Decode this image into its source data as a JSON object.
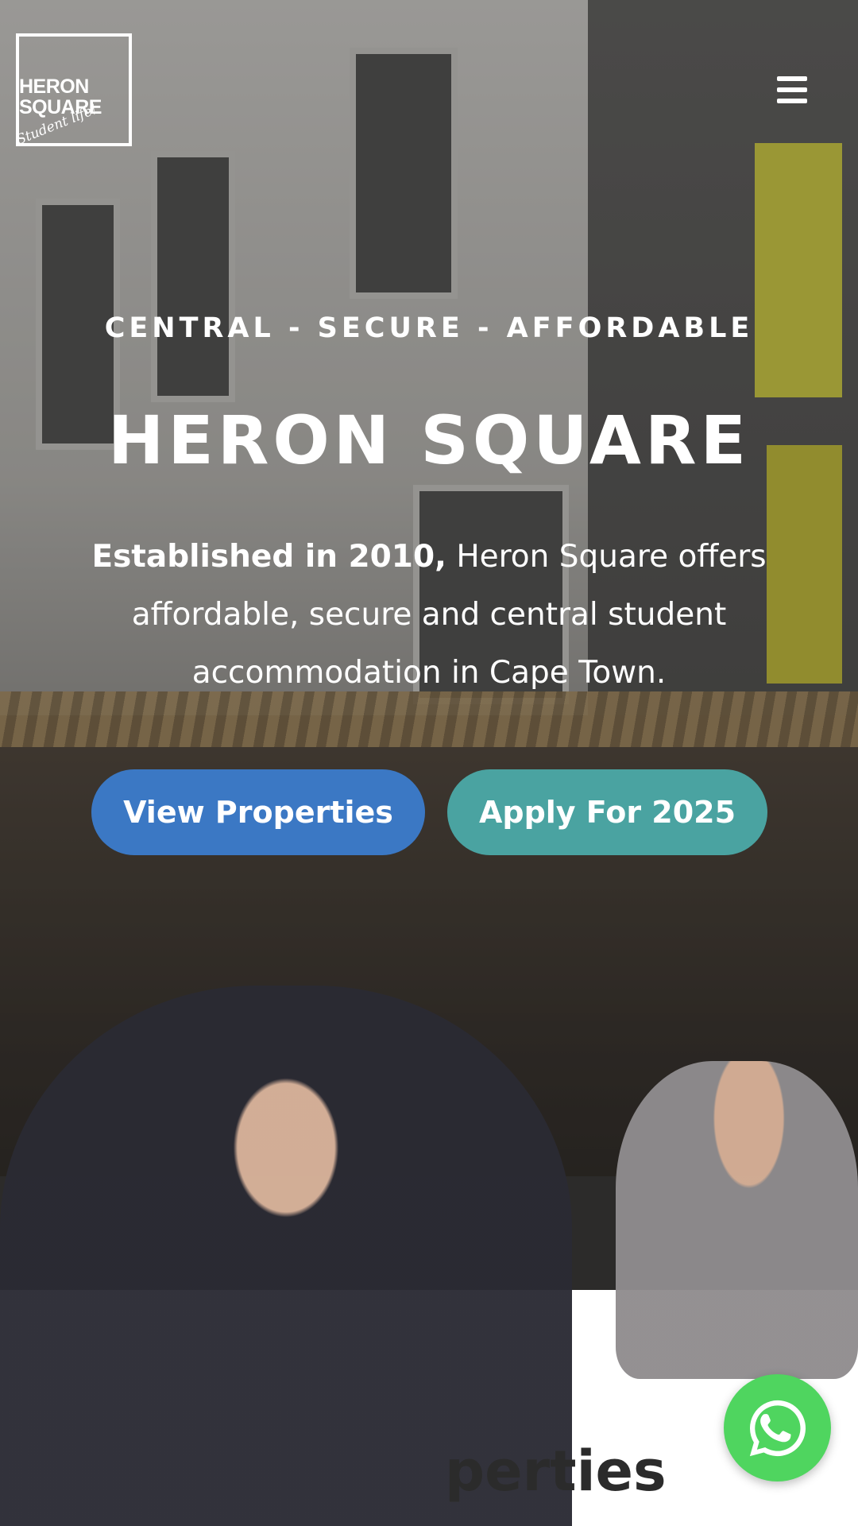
{
  "brand": {
    "logo_line1": "HERON",
    "logo_line2": "SQUARE",
    "logo_tagline": "Student life!"
  },
  "hero": {
    "eyebrow": "CENTRAL - SECURE - AFFORDABLE",
    "title": "HERON SQUARE",
    "intro_bold": "Established in 2010,",
    "intro_text": "Heron Square offers affordable, secure and central student accommodation in Cape Town."
  },
  "buttons": {
    "view_properties": "View Properties",
    "apply": "Apply For 2025"
  },
  "section": {
    "title_visible": "perties"
  },
  "icons": {
    "menu": "hamburger-menu-icon",
    "chat": "whatsapp-icon"
  },
  "colors": {
    "view_button": "#3b78c4",
    "apply_button": "#4aa3a1",
    "whatsapp": "#4fd55f"
  }
}
